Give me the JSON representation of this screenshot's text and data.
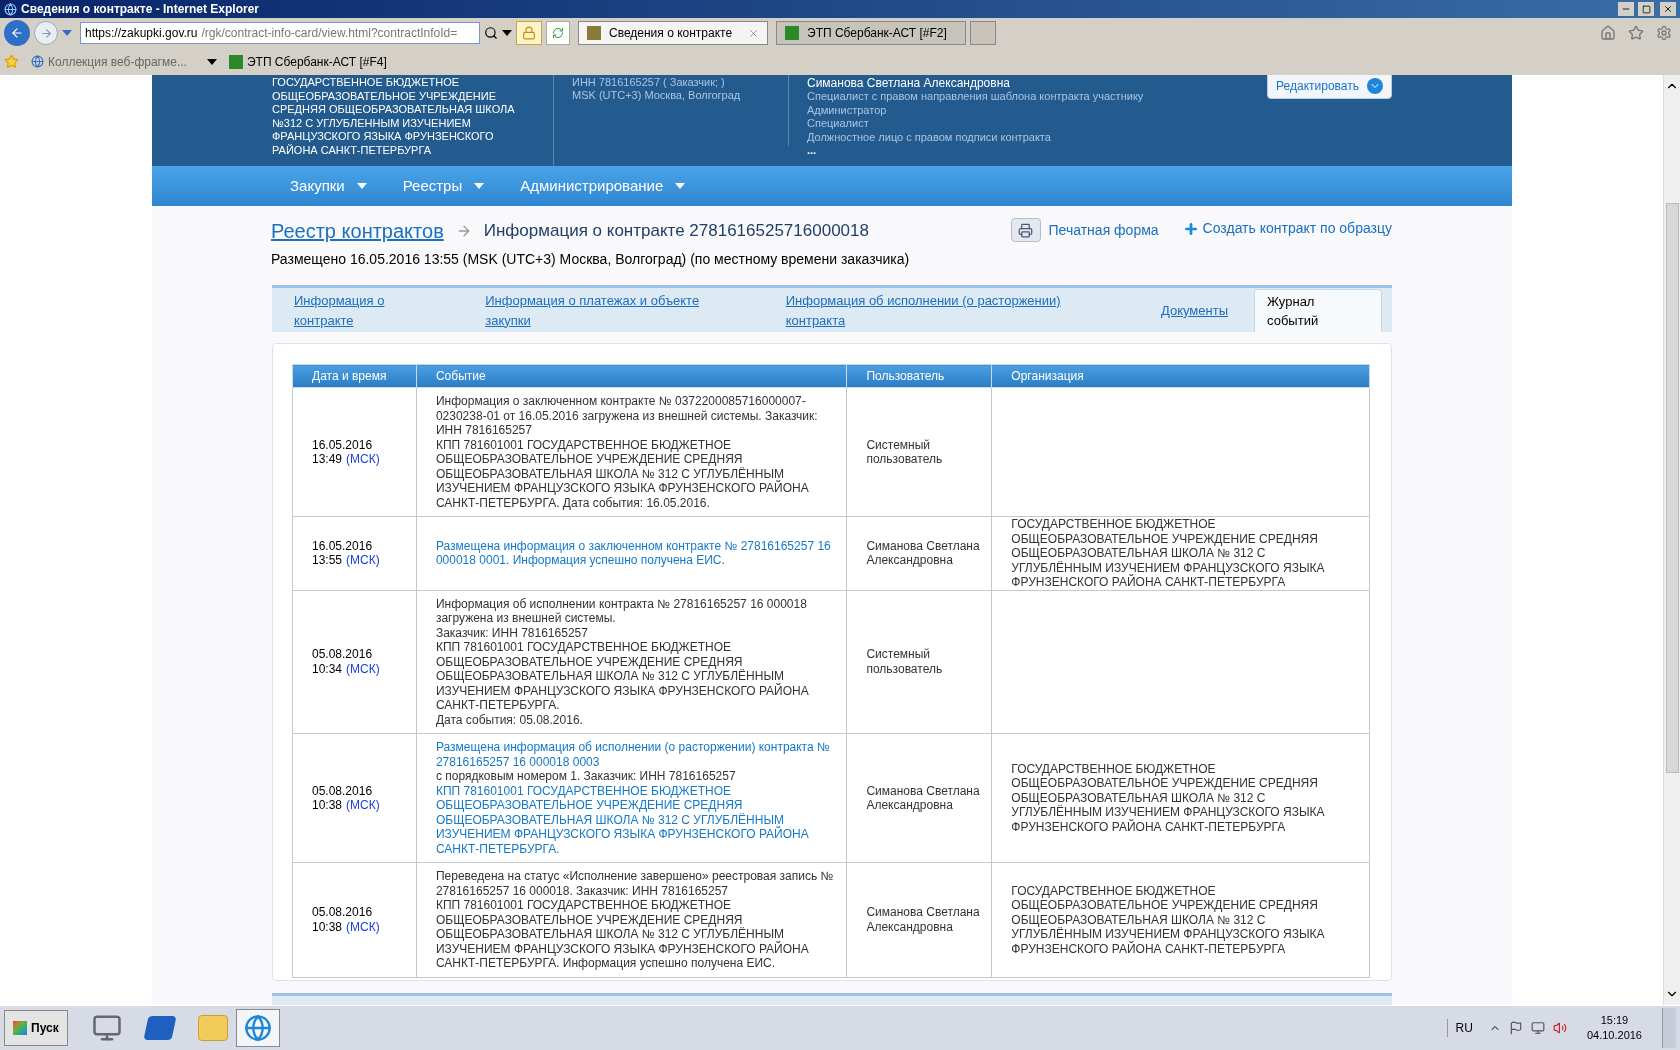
{
  "window": {
    "title": "Сведения о контракте - Internet Explorer"
  },
  "browser": {
    "address_host": "https://zakupki.gov.ru",
    "address_path": "/rgk/contract-info-card/view.html?contractInfoId=",
    "tabs": [
      {
        "label": "Сведения о контракте",
        "selected": true
      },
      {
        "label": "ЭТП Сбербанк-АСТ [#F2]",
        "selected": false
      }
    ],
    "favorites": [
      {
        "label": "Коллекция веб-фрагме...",
        "kind": "dropdown"
      },
      {
        "label": "ЭТП Сбербанк-АСТ [#F4]",
        "kind": "link"
      }
    ]
  },
  "header": {
    "org_name": "ГОСУДАРСТВЕННОЕ БЮДЖЕТНОЕ ОБЩЕОБРАЗОВАТЕЛЬНОЕ УЧРЕЖДЕНИЕ СРЕДНЯЯ ОБЩЕОБРАЗОВАТЕЛЬНАЯ ШКОЛА №312 С УГЛУБЛЕННЫМ ИЗУЧЕНИЕМ ФРАНЦУЗСКОГО ЯЗЫКА ФРУНЗЕНСКОГО РАЙОНА САНКТ-ПЕТЕРБУРГА",
    "info": [
      "ИНН 7816165257 ( Заказчик; )",
      "MSK (UTC+3) Москва, Волгоград"
    ],
    "user_name": "Симанова Светлана Александровна",
    "roles": [
      "Специалист с правом направления шаблона контракта участнику",
      "Администратор",
      "Специалист",
      "Должностное лицо с правом подписи контракта"
    ],
    "more": "...",
    "edit_button": "Редактировать"
  },
  "nav": [
    "Закупки",
    "Реестры",
    "Администрирование"
  ],
  "breadcrumb": {
    "link": "Реестр контрактов",
    "title": "Информация о контракте 2781616525716000018"
  },
  "posted": "Размещено 16.05.2016 13:55 (MSK (UTC+3) Москва, Волгоград) (по местному времени заказчика)",
  "actions": [
    {
      "label": "Печатная форма",
      "kind": "print"
    },
    {
      "label": "Создать контракт по образцу",
      "kind": "create"
    }
  ],
  "tabs": [
    {
      "label": "Информация о контракте",
      "selected": false
    },
    {
      "label": "Информация о платежах и объекте закупки",
      "selected": false
    },
    {
      "label": "Информация об исполнении (о расторжении) контракта",
      "selected": false
    },
    {
      "label": "Документы",
      "selected": false
    },
    {
      "label": "Журнал событий",
      "selected": true
    }
  ],
  "table": {
    "columns": [
      "Дата и время",
      "Событие",
      "Пользователь",
      "Организация"
    ],
    "rows": [
      {
        "date": "16.05.2016",
        "time": "13:49",
        "tz": "(МСК)",
        "event": [
          {
            "text": "Информация о заключенном контракте № 0372200085716000007-0230238-01 от 16.05.2016 загружена из внешней системы. Заказчик: ИНН 7816165257\nКПП 781601001 ГОСУДАРСТВЕННОЕ БЮДЖЕТНОЕ ОБЩЕОБРАЗОВАТЕЛЬНОЕ УЧРЕЖДЕНИЕ СРЕДНЯЯ ОБЩЕОБРАЗОВАТЕЛЬНАЯ ШКОЛА № 312 С УГЛУБЛЁННЫМ ИЗУЧЕНИЕМ ФРАНЦУЗСКОГО ЯЗЫКА ФРУНЗЕНСКОГО РАЙОНА САНКТ-ПЕТЕРБУРГА. Дата события: 16.05.2016.",
            "link": false
          }
        ],
        "user": "Системный пользователь"
      },
      {
        "date": "16.05.2016",
        "time": "13:55",
        "tz": "(МСК)",
        "event": [
          {
            "text": "Размещена информация о заключенном контракте № 27816165257 16 000018 0001. Информация успешно получена ЕИС.",
            "link": true
          }
        ],
        "user": "Симанова Светлана Александровна",
        "org": "ГОСУДАРСТВЕННОЕ БЮДЖЕТНОЕ ОБЩЕОБРАЗОВАТЕЛЬНОЕ УЧРЕЖДЕНИЕ СРЕДНЯЯ ОБЩЕОБРАЗОВАТЕЛЬНАЯ ШКОЛА № 312 С УГЛУБЛЁННЫМ ИЗУЧЕНИЕМ ФРАНЦУЗСКОГО ЯЗЫКА ФРУНЗЕНСКОГО РАЙОНА САНКТ-ПЕТЕРБУРГА"
      },
      {
        "date": "05.08.2016",
        "time": "10:34",
        "tz": "(МСК)",
        "event": [
          {
            "text": "Информация об исполнении контракта № 27816165257 16 000018 загружена из внешней системы.\nЗаказчик: ИНН 7816165257\nКПП 781601001 ГОСУДАРСТВЕННОЕ БЮДЖЕТНОЕ ОБЩЕОБРАЗОВАТЕЛЬНОЕ УЧРЕЖДЕНИЕ СРЕДНЯЯ ОБЩЕОБРАЗОВАТЕЛЬНАЯ ШКОЛА № 312 С УГЛУБЛЁННЫМ ИЗУЧЕНИЕМ ФРАНЦУЗСКОГО ЯЗЫКА ФРУНЗЕНСКОГО РАЙОНА САНКТ-ПЕТЕРБУРГА.\nДата события: 05.08.2016.",
            "link": false
          }
        ],
        "user": "Системный пользователь"
      },
      {
        "date": "05.08.2016",
        "time": "10:38",
        "tz": "(МСК)",
        "event": [
          {
            "text": "Размещена информация об исполнении (о расторжении) контракта № 27816165257 16 000018 0003",
            "link": true
          },
          {
            "text": " с порядковым номером 1. Заказчик: ИНН 7816165257\n",
            "link": false
          },
          {
            "text": "КПП 781601001 ГОСУДАРСТВЕННОЕ БЮДЖЕТНОЕ ОБЩЕОБРАЗОВАТЕЛЬНОЕ УЧРЕЖДЕНИЕ СРЕДНЯЯ ОБЩЕОБРАЗОВАТЕЛЬНАЯ ШКОЛА № 312 С УГЛУБЛЁННЫМ ИЗУЧЕНИЕМ ФРАНЦУЗСКОГО ЯЗЫКА ФРУНЗЕНСКОГО РАЙОНА САНКТ-ПЕТЕРБУРГА.",
            "link": true
          }
        ],
        "user": "Симанова Светлана Александровна",
        "org": "ГОСУДАРСТВЕННОЕ БЮДЖЕТНОЕ ОБЩЕОБРАЗОВАТЕЛЬНОЕ УЧРЕЖДЕНИЕ СРЕДНЯЯ ОБЩЕОБРАЗОВАТЕЛЬНАЯ ШКОЛА № 312 С УГЛУБЛЁННЫМ ИЗУЧЕНИЕМ ФРАНЦУЗСКОГО ЯЗЫКА ФРУНЗЕНСКОГО РАЙОНА САНКТ-ПЕТЕРБУРГА"
      },
      {
        "date": "05.08.2016",
        "time": "10:38",
        "tz": "(МСК)",
        "event": [
          {
            "text": "Переведена на статус «Исполнение завершено» реестровая запись № 27816165257 16 000018. Заказчик: ИНН 7816165257\nКПП 781601001 ГОСУДАРСТВЕННОЕ БЮДЖЕТНОЕ ОБЩЕОБРАЗОВАТЕЛЬНОЕ УЧРЕЖДЕНИЕ СРЕДНЯЯ ОБЩЕОБРАЗОВАТЕЛЬНАЯ ШКОЛА № 312 С УГЛУБЛЁННЫМ ИЗУЧЕНИЕМ ФРАНЦУЗСКОГО ЯЗЫКА ФРУНЗЕНСКОГО РАЙОНА САНКТ-ПЕТЕРБУРГА. Информация успешно получена ЕИС.",
            "link": false
          }
        ],
        "user": "Симанова Светлана Александровна",
        "org": "ГОСУДАРСТВЕННОЕ БЮДЖЕТНОЕ ОБЩЕОБРАЗОВАТЕЛЬНОЕ УЧРЕЖДЕНИЕ СРЕДНЯЯ ОБЩЕОБРАЗОВАТЕЛЬНАЯ ШКОЛА № 312 С УГЛУБЛЁННЫМ ИЗУЧЕНИЕМ ФРАНЦУЗСКОГО ЯЗЫКА ФРУНЗЕНСКОГО РАЙОНА САНКТ-ПЕТЕРБУРГА"
      }
    ]
  },
  "taskbar": {
    "start": "Пуск",
    "lang": "RU",
    "time": "15:19",
    "date": "04.10.2016"
  }
}
